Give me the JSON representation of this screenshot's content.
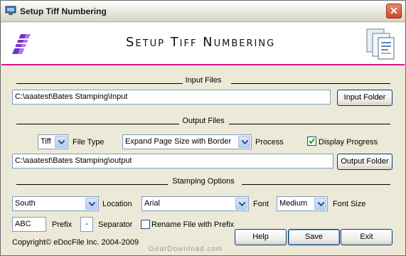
{
  "window": {
    "title": "Setup Tiff Numbering"
  },
  "banner": {
    "title": "Setup Tiff Numbering"
  },
  "input_section": {
    "header": "Input Files",
    "path": "C:\\aaatest\\Bates Stamping\\Input",
    "folder_button": "Input Folder"
  },
  "output_section": {
    "header": "Output Files",
    "file_type_value": "Tiff",
    "file_type_label": "File Type",
    "process_value": "Expand Page Size with Border",
    "process_label": "Process",
    "display_progress_label": "Display Progress",
    "display_progress_checked": true,
    "path": "C:\\aaatest\\Bates Stamping\\output",
    "folder_button": "Output Folder"
  },
  "stamping_section": {
    "header": "Stamping Options",
    "location_value": "South",
    "location_label": "Location",
    "font_value": "Arial",
    "font_label": "Font",
    "font_size_value": "Medium",
    "font_size_label": "Font Size",
    "prefix_value": "ABC",
    "prefix_label": "Prefix",
    "separator_value": "-",
    "separator_label": "Separator",
    "rename_label": "Rename File with Prefix",
    "rename_checked": false
  },
  "footer": {
    "copyright": "Copyright© eDocFile Inc. 2004-2009",
    "help_button": "Help",
    "save_button": "Save",
    "exit_button": "Exit",
    "watermark": "GearDownload.com"
  },
  "colors": {
    "accent_line": "#e0188c",
    "logo": "#7a2fd0",
    "dialog_bg": "#ece9d8"
  }
}
